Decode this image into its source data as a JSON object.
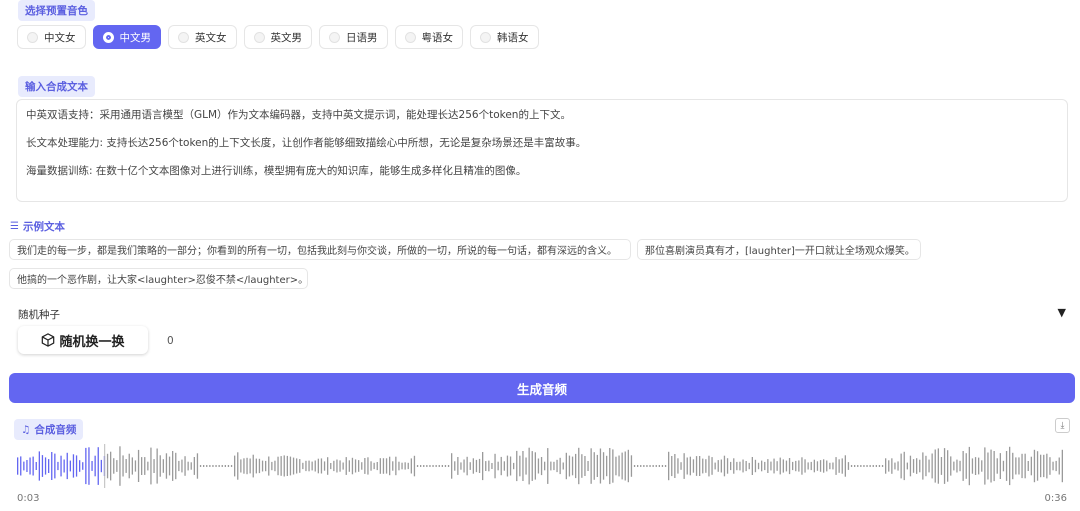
{
  "voice_section": {
    "label": "选择预置音色",
    "options": [
      "中文女",
      "中文男",
      "英文女",
      "英文男",
      "日语男",
      "粤语女",
      "韩语女"
    ],
    "selected": "中文男"
  },
  "input_section": {
    "label": "输入合成文本",
    "lines": [
      "中英双语支持：采用通用语言模型（GLM）作为文本编码器，支持中英文提示词，能处理长达256个token的上下文。",
      "长文本处理能力: 支持长达256个token的上下文长度，让创作者能够细致描绘心中所想，无论是复杂场景还是丰富故事。",
      "海量数据训练: 在数十亿个文本图像对上进行训练，模型拥有庞大的知识库，能够生成多样化且精准的图像。"
    ]
  },
  "examples": {
    "label": "示例文本",
    "items": [
      "我们走的每一步，都是我们策略的一部分；你看到的所有一切，包括我此刻与你交谈，所做的一切，所说的每一句话，都有深远的含义。",
      "那位喜剧演员真有才，[laughter]一开口就让全场观众爆笑。",
      "他搞的一个恶作剧，让大家<laughter>忍俊不禁</laughter>。"
    ]
  },
  "seed": {
    "label": "随机种子",
    "toggle_icon": "▼",
    "button_label": "随机换一换",
    "value": "0"
  },
  "generate": {
    "label": "生成音频"
  },
  "output": {
    "label": "合成音频",
    "current_time": "0:03",
    "duration": "0:36",
    "progress": 0.083,
    "accent_color": "#6366f1"
  }
}
